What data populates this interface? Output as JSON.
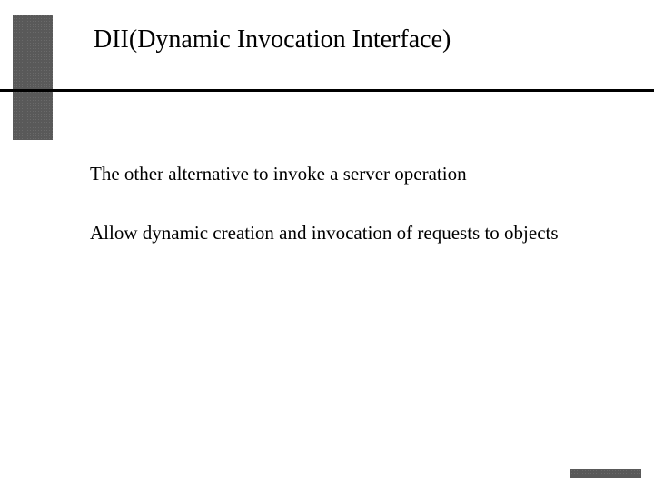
{
  "title": "DII(Dynamic Invocation Interface)",
  "bullets": [
    "The other alternative to invoke a server operation",
    "Allow dynamic creation and invocation of requests to objects"
  ]
}
